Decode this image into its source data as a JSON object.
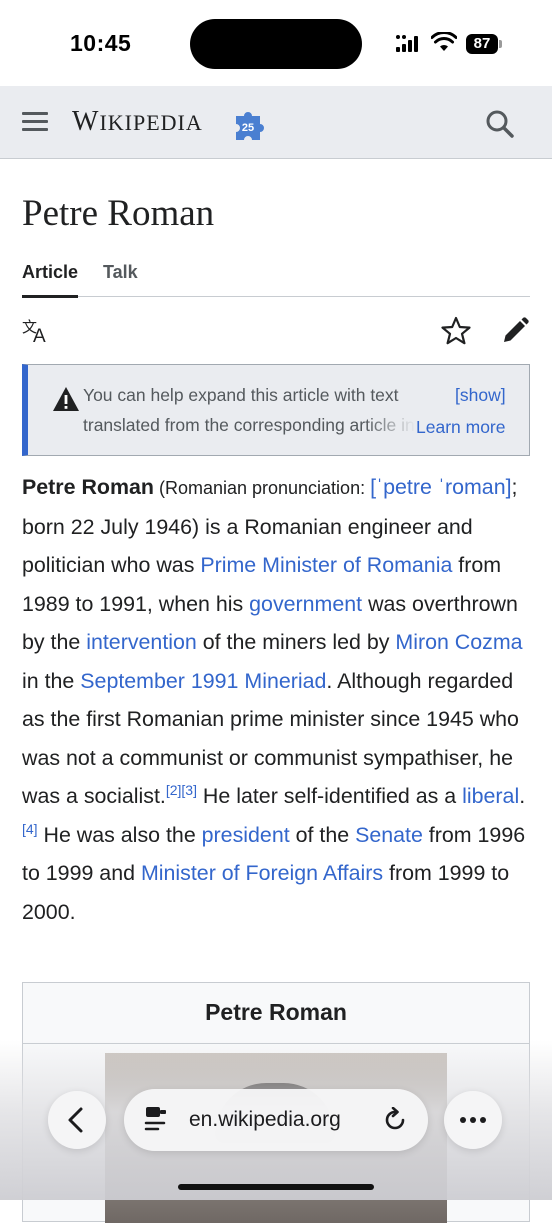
{
  "status_bar": {
    "time": "10:45",
    "battery": "87"
  },
  "header": {
    "logo_main": "W",
    "logo_small": "IKIPEDIA",
    "logo_suffix": "A",
    "menu_icon": "hamburger-menu-icon",
    "search_icon": "search-icon",
    "badge_icon": "wikipedia-25-puzzle-icon"
  },
  "article": {
    "title": "Petre Roman",
    "tabs": [
      "Article",
      "Talk"
    ]
  },
  "notice": {
    "line1": "You can help expand this article with text",
    "line2": "translated from the corresponding article in",
    "show": "[show]",
    "learn_more": "Learn more"
  },
  "body": {
    "name": "Petre Roman",
    "pron_open": " (Romanian pronunciation: ",
    "ipa": "[ˈpetre ˈroman]",
    "t1": "; born 22 July 1946) is a Romanian engineer and politician who was ",
    "l_pm": "Prime Minister of Romania",
    "t2": " from 1989 to 1991, when his ",
    "l_gov": "government",
    "t3": " was overthrown by the ",
    "l_int": "intervention",
    "t4": " of the miners led by ",
    "l_miron": "Miron Cozma",
    "t5": " in the ",
    "l_sep": "September 1991 Mineriad",
    "t6": ". Although regarded as the first Romanian prime minister since 1945 who was not a communist or communist sympathiser, he was a socialist.",
    "ref1": "[2][3]",
    "t7": " He later self-identified as a ",
    "l_lib": "liberal",
    "t8": ".",
    "ref2": "[4]",
    "t9": " He was also the ",
    "l_pres": "president",
    "t10": " of the ",
    "l_sen": "Senate",
    "t11": " from 1996 to 1999 and ",
    "l_mfa": "Minister of Foreign Affairs",
    "t12": " from 1999 to 2000."
  },
  "infobox": {
    "title": "Petre Roman"
  },
  "browser": {
    "url": "en.wikipedia.org"
  },
  "colors": {
    "link": "#3366cc",
    "header_bg": "#eaecf0",
    "notice_accent": "#3366cc"
  }
}
